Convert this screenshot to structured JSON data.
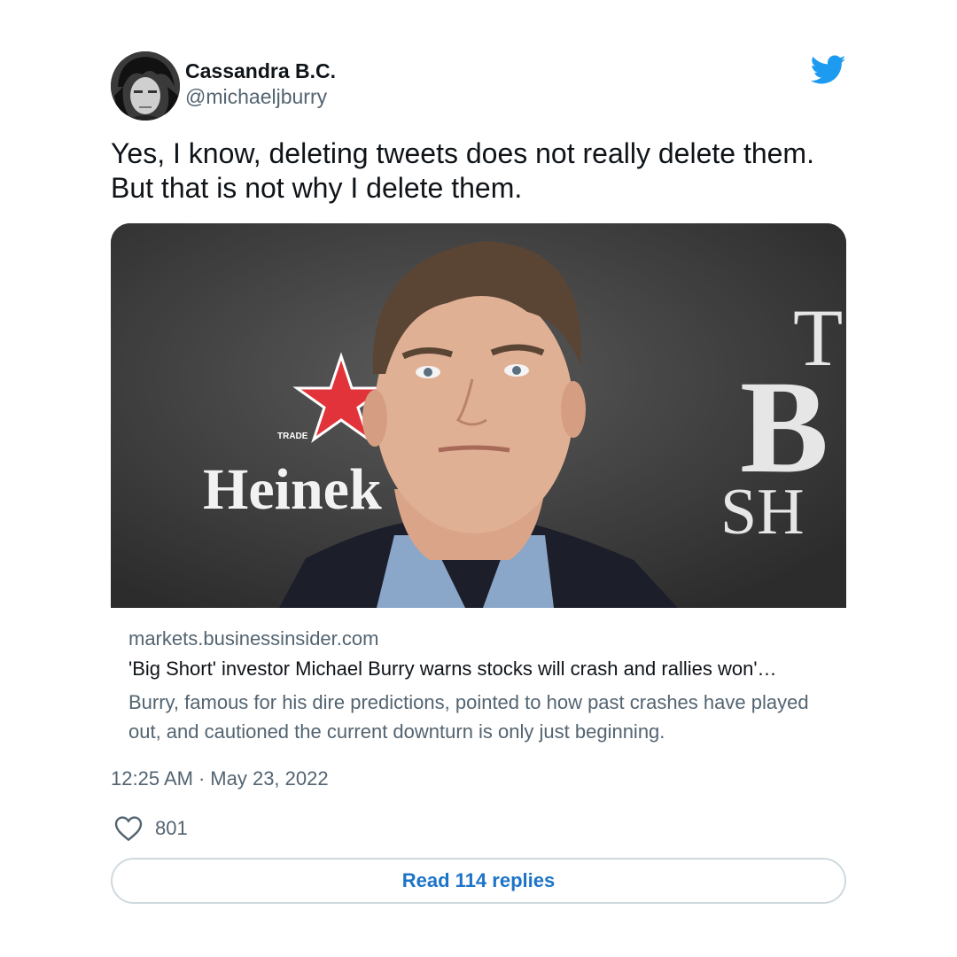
{
  "author": {
    "display_name": "Cassandra B.C.",
    "handle": "@michaeljburry"
  },
  "tweet": {
    "text_line1": "Yes, I know, deleting tweets does not really delete them.",
    "text_line2": "But that is not why I delete them."
  },
  "card": {
    "image_sign_left": "Heinek",
    "image_sign_trade": "TRADE",
    "image_sign_right_1": "T",
    "image_sign_right_2": "B",
    "image_sign_right_3": "SH",
    "domain": "markets.businessinsider.com",
    "title": "'Big Short' investor Michael Burry warns stocks will crash and rallies won'…",
    "description": "Burry, famous for his dire predictions, pointed to how past crashes have played out, and cautioned the current downturn is only just beginning."
  },
  "meta": {
    "time": "12:25 AM",
    "separator": "·",
    "date": "May 23, 2022"
  },
  "likes": {
    "count": "801",
    "icon": "heart-outline-icon"
  },
  "replies_button": {
    "label": "Read 114 replies"
  },
  "colors": {
    "twitter_blue": "#1d9bf0",
    "link_blue": "#1d74c6",
    "secondary_text": "#536471"
  }
}
